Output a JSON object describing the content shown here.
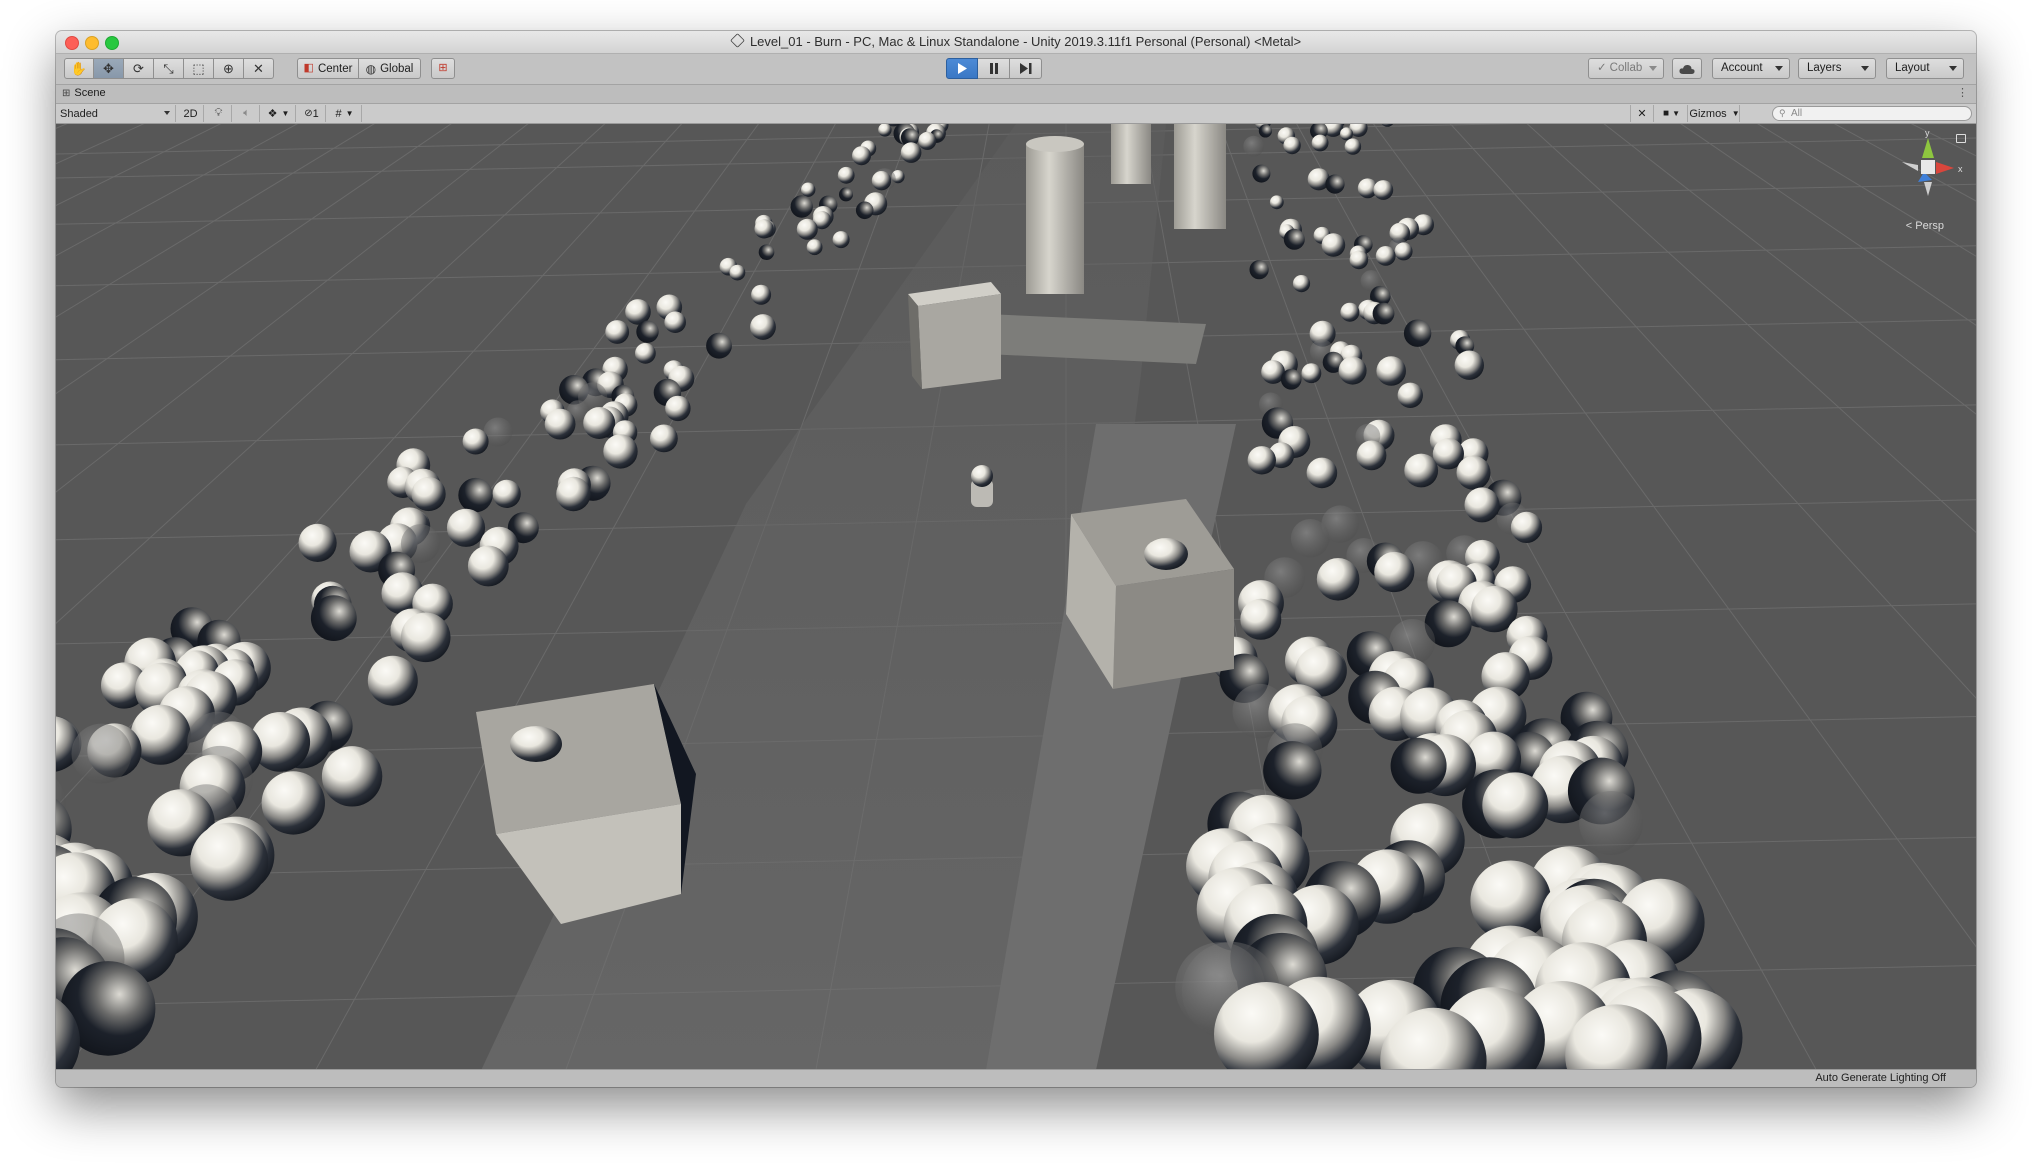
{
  "window": {
    "title": "Level_01 - Burn - PC, Mac & Linux Standalone - Unity 2019.3.11f1 Personal (Personal) <Metal>"
  },
  "toolbar": {
    "tools": [
      {
        "name": "hand-tool",
        "icon": "hand-icon",
        "glyph": "✋"
      },
      {
        "name": "move-tool",
        "icon": "move-arrows-icon",
        "glyph": "✥"
      },
      {
        "name": "rotate-tool",
        "icon": "rotate-icon",
        "glyph": "⟳"
      },
      {
        "name": "scale-tool",
        "icon": "scale-icon",
        "glyph": "⤡"
      },
      {
        "name": "rect-tool",
        "icon": "rect-transform-icon",
        "glyph": "⬚"
      },
      {
        "name": "transform-tool",
        "icon": "transform-icon",
        "glyph": "⊕"
      },
      {
        "name": "custom-tool",
        "icon": "custom-tool-icon",
        "glyph": "✕"
      }
    ],
    "pivot_label": "Center",
    "space_label": "Global",
    "snap_icon": "grid-snap-icon",
    "collab_label": "Collab",
    "account_label": "Account",
    "layers_label": "Layers",
    "layout_label": "Layout",
    "active_tool": "move-tool",
    "playing": true
  },
  "tabs": {
    "scene_label": "Scene"
  },
  "scene_toolbar": {
    "draw_mode": "Shaded",
    "mode_2d_label": "2D",
    "hidden_count": "1",
    "gizmos_label": "Gizmos",
    "search_placeholder": "All",
    "projection_label": "Persp"
  },
  "gizmo_axes": {
    "y": "y",
    "x": "x",
    "y_color": "#8ec63f",
    "x_color": "#d9463c",
    "z_color": "#3f7fd8"
  },
  "colors": {
    "viewport_bg": "#575757",
    "sphere_light": "#f2f1ec",
    "sphere_dark": "#141922",
    "floor": "#6b6b6b"
  },
  "status": {
    "lighting_text": "Auto Generate Lighting Off"
  }
}
